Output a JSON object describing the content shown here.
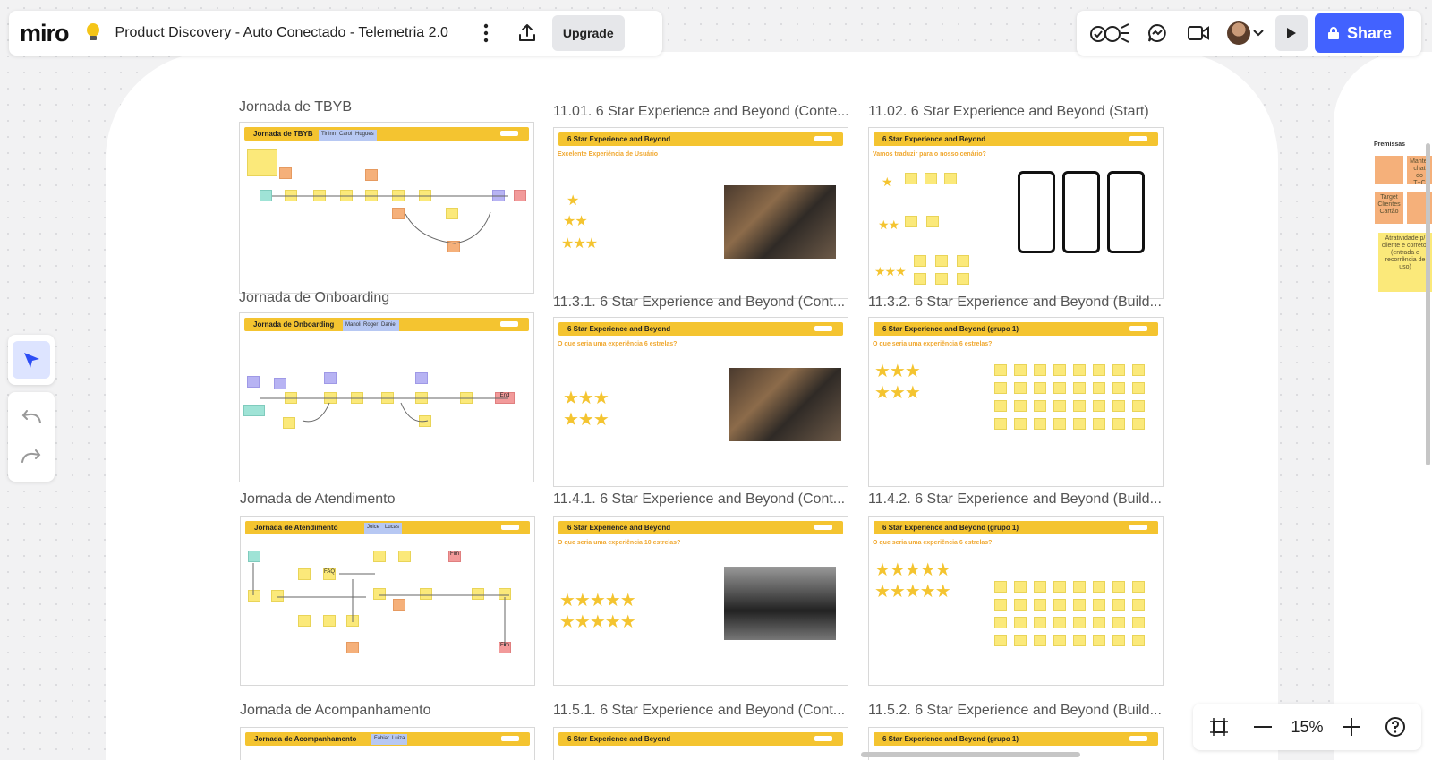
{
  "app": {
    "logo": "miro",
    "board_title": "Product Discovery - Auto Conectado - Telemetria 2.0",
    "upgrade_label": "Upgrade",
    "share_label": "Share"
  },
  "zoom": {
    "value": "15%"
  },
  "frames": [
    {
      "title": "Jornada de TBYB",
      "bar": "Jornada de TBYB",
      "chips": [
        "Tininn",
        "Carol",
        "Hugues"
      ]
    },
    {
      "title": "11.01. 6 Star Experience and Beyond (Conte...",
      "bar": "6 Star Experience and Beyond",
      "subtitle": "Excelente Experiência de Usuário"
    },
    {
      "title": "11.02. 6 Star Experience and Beyond (Start)",
      "bar": "6 Star Experience and Beyond",
      "subtitle": "Vamos traduzir para o nosso cenário?"
    },
    {
      "title": "Jornada de Onboarding",
      "bar": "Jornada de Onboarding",
      "chips": [
        "Manoli",
        "Roger",
        "Daniel"
      ]
    },
    {
      "title": "11.3.1. 6 Star Experience and Beyond (Cont...",
      "bar": "6 Star Experience and Beyond",
      "subtitle": "O que seria uma experiência 6 estrelas?"
    },
    {
      "title": "11.3.2. 6 Star Experience and Beyond (Build...",
      "bar": "6 Star Experience and Beyond (grupo 1)",
      "subtitle": "O que seria uma experiência 6 estrelas?"
    },
    {
      "title": "Jornada de Atendimento",
      "bar": "Jornada de Atendimento",
      "chips": [
        "Joice",
        "Lucas"
      ]
    },
    {
      "title": "11.4.1. 6 Star Experience and Beyond (Cont...",
      "bar": "6 Star Experience and Beyond",
      "subtitle": "O que seria uma experiência 10 estrelas?"
    },
    {
      "title": "11.4.2. 6 Star Experience and Beyond (Build...",
      "bar": "6 Star Experience and Beyond (grupo 1)",
      "subtitle": "O que seria uma experiência 6 estrelas?"
    },
    {
      "title": "Jornada de Acompanhamento",
      "bar": "Jornada de Acompanhamento",
      "chips": [
        "Fabian",
        "Luiza"
      ]
    },
    {
      "title": "11.5.1. 6 Star Experience and Beyond (Cont...",
      "bar": "6 Star Experience and Beyond"
    },
    {
      "title": "11.5.2. 6 Star Experience and Beyond (Build...",
      "bar": "6 Star Experience and Beyond (grupo 1)"
    }
  ],
  "premises": {
    "label": "Premissas",
    "notes": [
      "Target Clientes Cartão",
      "Atratividade p/ cliente e corretor (entrada e recorrência de uso)",
      "Manter chat do T+C"
    ]
  },
  "node_labels": {
    "end": "End",
    "fim": "Fim",
    "faq": "FAQ"
  }
}
